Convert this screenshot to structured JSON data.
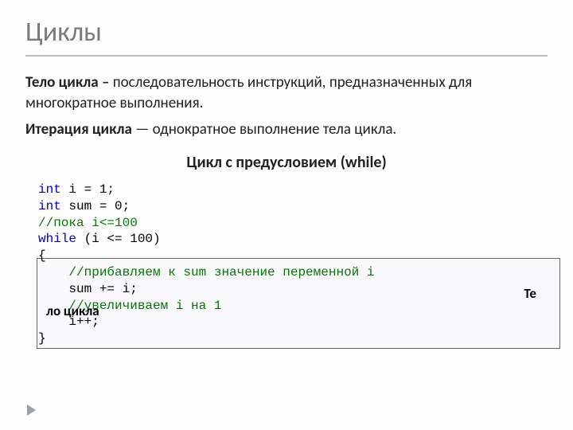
{
  "title": "Циклы",
  "para1": {
    "bold": "Тело цикла – ",
    "rest": "последовательность инструкций, предназначенных для многократное выполнения."
  },
  "para2": {
    "bold": "Итерация цикла",
    "rest": " — однократное выполнение тела цикла."
  },
  "subhead": "Цикл с предусловием (while)",
  "code": {
    "l1a": "int",
    "l1b": " i = 1;",
    "l2a": "int",
    "l2b": " sum = 0;",
    "l3": "//пока i<=100",
    "l4a": "while",
    "l4b": " (i <= 100)",
    "l5": "{",
    "l6": "    //прибавляем к sum значение переменной i",
    "l7": "    sum += i;",
    "l8": "    //увеличиваем i на 1",
    "l9": "    i++;",
    "l10": "}"
  },
  "body_label_right": "Те",
  "body_label_left": "ло цикла"
}
